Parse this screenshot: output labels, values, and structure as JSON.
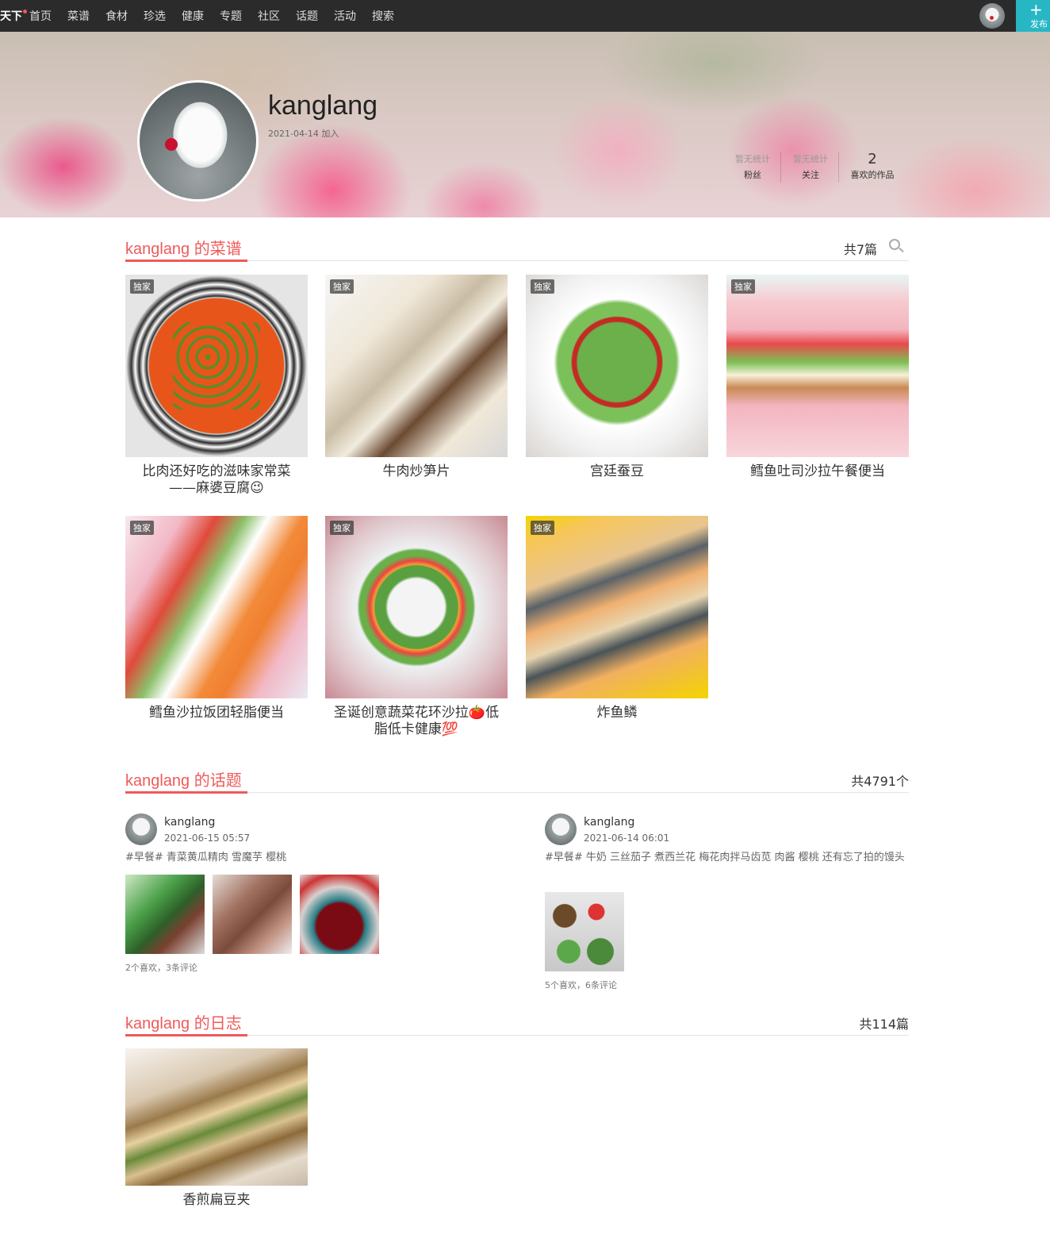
{
  "nav": {
    "logo": "天下",
    "links": [
      "首页",
      "菜谱",
      "食材",
      "珍选",
      "健康",
      "专题",
      "社区",
      "话题",
      "活动",
      "搜索"
    ],
    "publish_label": "发布"
  },
  "profile": {
    "username": "kanglang",
    "join_date": "2021-04-14 加入",
    "stats": [
      {
        "value": "暂无统计",
        "label": "粉丝"
      },
      {
        "value": "暂无统计",
        "label": "关注"
      },
      {
        "value": "2",
        "label": "喜欢的作品"
      }
    ]
  },
  "recipes": {
    "title": "kanglang 的菜谱",
    "count": "共7篇",
    "items": [
      {
        "badge": "独家",
        "title": "比肉还好吃的滋味家常菜——麻婆豆腐😉"
      },
      {
        "badge": "独家",
        "title": "牛肉炒笋片"
      },
      {
        "badge": "独家",
        "title": "宫廷蚕豆"
      },
      {
        "badge": "独家",
        "title": "鳕鱼吐司沙拉午餐便当"
      },
      {
        "badge": "独家",
        "title": "鳕鱼沙拉饭团轻脂便当"
      },
      {
        "badge": "独家",
        "title": "圣诞创意蔬菜花环沙拉🍅低脂低卡健康💯"
      },
      {
        "badge": "独家",
        "title": "炸鱼鳞"
      }
    ]
  },
  "topics": {
    "title": "kanglang 的话题",
    "count": "共4791个",
    "items": [
      {
        "user": "kanglang",
        "date": "2021-06-15 05:57",
        "text": "#早餐# 青菜黄瓜精肉 雪魔芋 樱桃",
        "meta": "2个喜欢，3条评论"
      },
      {
        "user": "kanglang",
        "date": "2021-06-14 06:01",
        "text": "#早餐# 牛奶 三丝茄子 煮西兰花 梅花肉拌马齿苋 肉酱 樱桃 还有忘了拍的馒头",
        "meta": "5个喜欢，6条评论"
      }
    ]
  },
  "diary": {
    "title": "kanglang 的日志",
    "count": "共114篇",
    "items": [
      {
        "title": "香煎扁豆夹"
      }
    ]
  }
}
